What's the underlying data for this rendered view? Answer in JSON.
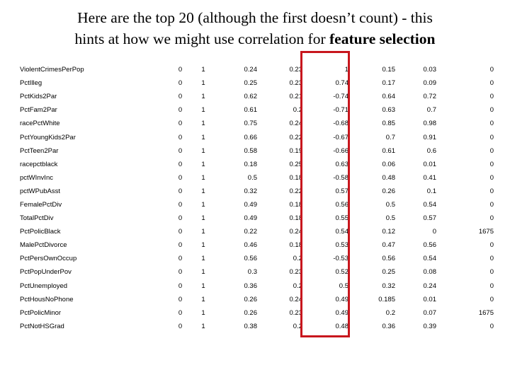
{
  "title": {
    "line1": "Here are the top 20 (although the first doesn’t count)  - this",
    "line2_prefix": "hints at how we might use correlation for ",
    "line2_bold": "feature selection"
  },
  "highlight": {
    "color": "#c8161d",
    "column_index": 5
  },
  "table": {
    "rows": [
      {
        "name": "ViolentCrimesPerPop",
        "values": [
          "0",
          "1",
          "0.24",
          "0.23",
          "1",
          "0.15",
          "0.03",
          "0"
        ]
      },
      {
        "name": "PctIlleg",
        "values": [
          "0",
          "1",
          "0.25",
          "0.23",
          "0.74",
          "0.17",
          "0.09",
          "0"
        ]
      },
      {
        "name": "PctKids2Par",
        "values": [
          "0",
          "1",
          "0.62",
          "0.21",
          "-0.74",
          "0.64",
          "0.72",
          "0"
        ]
      },
      {
        "name": "PctFam2Par",
        "values": [
          "0",
          "1",
          "0.61",
          "0.2",
          "-0.71",
          "0.63",
          "0.7",
          "0"
        ]
      },
      {
        "name": "racePctWhite",
        "values": [
          "0",
          "1",
          "0.75",
          "0.24",
          "-0.68",
          "0.85",
          "0.98",
          "0"
        ]
      },
      {
        "name": "PctYoungKids2Par",
        "values": [
          "0",
          "1",
          "0.66",
          "0.22",
          "-0.67",
          "0.7",
          "0.91",
          "0"
        ]
      },
      {
        "name": "PctTeen2Par",
        "values": [
          "0",
          "1",
          "0.58",
          "0.19",
          "-0.66",
          "0.61",
          "0.6",
          "0"
        ]
      },
      {
        "name": "racepctblack",
        "values": [
          "0",
          "1",
          "0.18",
          "0.25",
          "0.63",
          "0.06",
          "0.01",
          "0"
        ]
      },
      {
        "name": "pctWInvInc",
        "values": [
          "0",
          "1",
          "0.5",
          "0.18",
          "-0.58",
          "0.48",
          "0.41",
          "0"
        ]
      },
      {
        "name": "pctWPubAsst",
        "values": [
          "0",
          "1",
          "0.32",
          "0.22",
          "0.57",
          "0.26",
          "0.1",
          "0"
        ]
      },
      {
        "name": "FemalePctDiv",
        "values": [
          "0",
          "1",
          "0.49",
          "0.18",
          "0.56",
          "0.5",
          "0.54",
          "0"
        ]
      },
      {
        "name": "TotalPctDiv",
        "values": [
          "0",
          "1",
          "0.49",
          "0.18",
          "0.55",
          "0.5",
          "0.57",
          "0"
        ]
      },
      {
        "name": "PctPolicBlack",
        "values": [
          "0",
          "1",
          "0.22",
          "0.24",
          "0.54",
          "0.12",
          "0",
          "1675"
        ]
      },
      {
        "name": "MalePctDivorce",
        "values": [
          "0",
          "1",
          "0.46",
          "0.18",
          "0.53",
          "0.47",
          "0.56",
          "0"
        ]
      },
      {
        "name": "PctPersOwnOccup",
        "values": [
          "0",
          "1",
          "0.56",
          "0.2",
          "-0.53",
          "0.56",
          "0.54",
          "0"
        ]
      },
      {
        "name": "PctPopUnderPov",
        "values": [
          "0",
          "1",
          "0.3",
          "0.23",
          "0.52",
          "0.25",
          "0.08",
          "0"
        ]
      },
      {
        "name": "PctUnemployed",
        "values": [
          "0",
          "1",
          "0.36",
          "0.2",
          "0.5",
          "0.32",
          "0.24",
          "0"
        ]
      },
      {
        "name": "PctHousNoPhone",
        "values": [
          "0",
          "1",
          "0.26",
          "0.24",
          "0.49",
          "0.185",
          "0.01",
          "0"
        ]
      },
      {
        "name": "PctPolicMinor",
        "values": [
          "0",
          "1",
          "0.26",
          "0.23",
          "0.49",
          "0.2",
          "0.07",
          "1675"
        ]
      },
      {
        "name": "PctNotHSGrad",
        "values": [
          "0",
          "1",
          "0.38",
          "0.2",
          "0.48",
          "0.36",
          "0.39",
          "0"
        ]
      }
    ]
  }
}
